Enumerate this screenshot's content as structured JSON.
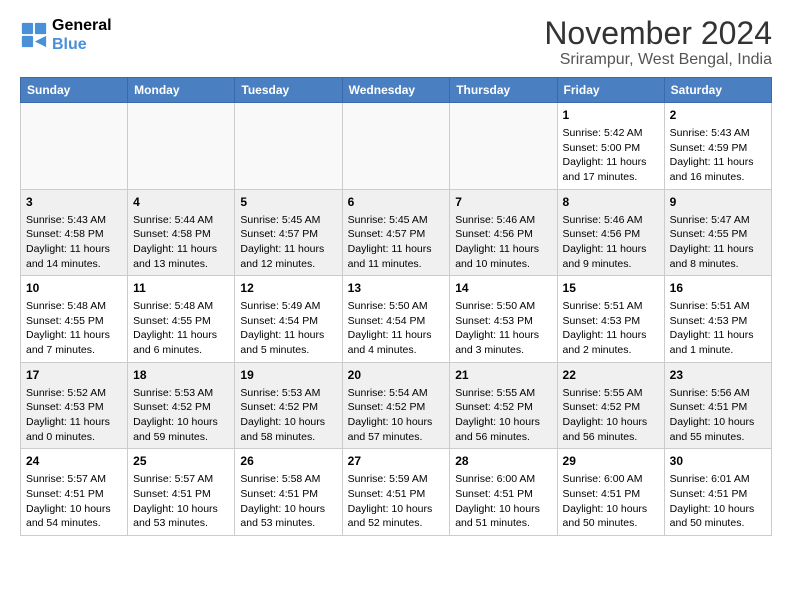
{
  "header": {
    "logo_line1": "General",
    "logo_line2": "Blue",
    "month": "November 2024",
    "location": "Srirampur, West Bengal, India"
  },
  "days_of_week": [
    "Sunday",
    "Monday",
    "Tuesday",
    "Wednesday",
    "Thursday",
    "Friday",
    "Saturday"
  ],
  "weeks": [
    {
      "days": [
        {
          "num": "",
          "content": ""
        },
        {
          "num": "",
          "content": ""
        },
        {
          "num": "",
          "content": ""
        },
        {
          "num": "",
          "content": ""
        },
        {
          "num": "",
          "content": ""
        },
        {
          "num": "1",
          "content": "Sunrise: 5:42 AM\nSunset: 5:00 PM\nDaylight: 11 hours\nand 17 minutes."
        },
        {
          "num": "2",
          "content": "Sunrise: 5:43 AM\nSunset: 4:59 PM\nDaylight: 11 hours\nand 16 minutes."
        }
      ]
    },
    {
      "days": [
        {
          "num": "3",
          "content": "Sunrise: 5:43 AM\nSunset: 4:58 PM\nDaylight: 11 hours\nand 14 minutes."
        },
        {
          "num": "4",
          "content": "Sunrise: 5:44 AM\nSunset: 4:58 PM\nDaylight: 11 hours\nand 13 minutes."
        },
        {
          "num": "5",
          "content": "Sunrise: 5:45 AM\nSunset: 4:57 PM\nDaylight: 11 hours\nand 12 minutes."
        },
        {
          "num": "6",
          "content": "Sunrise: 5:45 AM\nSunset: 4:57 PM\nDaylight: 11 hours\nand 11 minutes."
        },
        {
          "num": "7",
          "content": "Sunrise: 5:46 AM\nSunset: 4:56 PM\nDaylight: 11 hours\nand 10 minutes."
        },
        {
          "num": "8",
          "content": "Sunrise: 5:46 AM\nSunset: 4:56 PM\nDaylight: 11 hours\nand 9 minutes."
        },
        {
          "num": "9",
          "content": "Sunrise: 5:47 AM\nSunset: 4:55 PM\nDaylight: 11 hours\nand 8 minutes."
        }
      ]
    },
    {
      "days": [
        {
          "num": "10",
          "content": "Sunrise: 5:48 AM\nSunset: 4:55 PM\nDaylight: 11 hours\nand 7 minutes."
        },
        {
          "num": "11",
          "content": "Sunrise: 5:48 AM\nSunset: 4:55 PM\nDaylight: 11 hours\nand 6 minutes."
        },
        {
          "num": "12",
          "content": "Sunrise: 5:49 AM\nSunset: 4:54 PM\nDaylight: 11 hours\nand 5 minutes."
        },
        {
          "num": "13",
          "content": "Sunrise: 5:50 AM\nSunset: 4:54 PM\nDaylight: 11 hours\nand 4 minutes."
        },
        {
          "num": "14",
          "content": "Sunrise: 5:50 AM\nSunset: 4:53 PM\nDaylight: 11 hours\nand 3 minutes."
        },
        {
          "num": "15",
          "content": "Sunrise: 5:51 AM\nSunset: 4:53 PM\nDaylight: 11 hours\nand 2 minutes."
        },
        {
          "num": "16",
          "content": "Sunrise: 5:51 AM\nSunset: 4:53 PM\nDaylight: 11 hours\nand 1 minute."
        }
      ]
    },
    {
      "days": [
        {
          "num": "17",
          "content": "Sunrise: 5:52 AM\nSunset: 4:53 PM\nDaylight: 11 hours\nand 0 minutes."
        },
        {
          "num": "18",
          "content": "Sunrise: 5:53 AM\nSunset: 4:52 PM\nDaylight: 10 hours\nand 59 minutes."
        },
        {
          "num": "19",
          "content": "Sunrise: 5:53 AM\nSunset: 4:52 PM\nDaylight: 10 hours\nand 58 minutes."
        },
        {
          "num": "20",
          "content": "Sunrise: 5:54 AM\nSunset: 4:52 PM\nDaylight: 10 hours\nand 57 minutes."
        },
        {
          "num": "21",
          "content": "Sunrise: 5:55 AM\nSunset: 4:52 PM\nDaylight: 10 hours\nand 56 minutes."
        },
        {
          "num": "22",
          "content": "Sunrise: 5:55 AM\nSunset: 4:52 PM\nDaylight: 10 hours\nand 56 minutes."
        },
        {
          "num": "23",
          "content": "Sunrise: 5:56 AM\nSunset: 4:51 PM\nDaylight: 10 hours\nand 55 minutes."
        }
      ]
    },
    {
      "days": [
        {
          "num": "24",
          "content": "Sunrise: 5:57 AM\nSunset: 4:51 PM\nDaylight: 10 hours\nand 54 minutes."
        },
        {
          "num": "25",
          "content": "Sunrise: 5:57 AM\nSunset: 4:51 PM\nDaylight: 10 hours\nand 53 minutes."
        },
        {
          "num": "26",
          "content": "Sunrise: 5:58 AM\nSunset: 4:51 PM\nDaylight: 10 hours\nand 53 minutes."
        },
        {
          "num": "27",
          "content": "Sunrise: 5:59 AM\nSunset: 4:51 PM\nDaylight: 10 hours\nand 52 minutes."
        },
        {
          "num": "28",
          "content": "Sunrise: 6:00 AM\nSunset: 4:51 PM\nDaylight: 10 hours\nand 51 minutes."
        },
        {
          "num": "29",
          "content": "Sunrise: 6:00 AM\nSunset: 4:51 PM\nDaylight: 10 hours\nand 50 minutes."
        },
        {
          "num": "30",
          "content": "Sunrise: 6:01 AM\nSunset: 4:51 PM\nDaylight: 10 hours\nand 50 minutes."
        }
      ]
    }
  ]
}
